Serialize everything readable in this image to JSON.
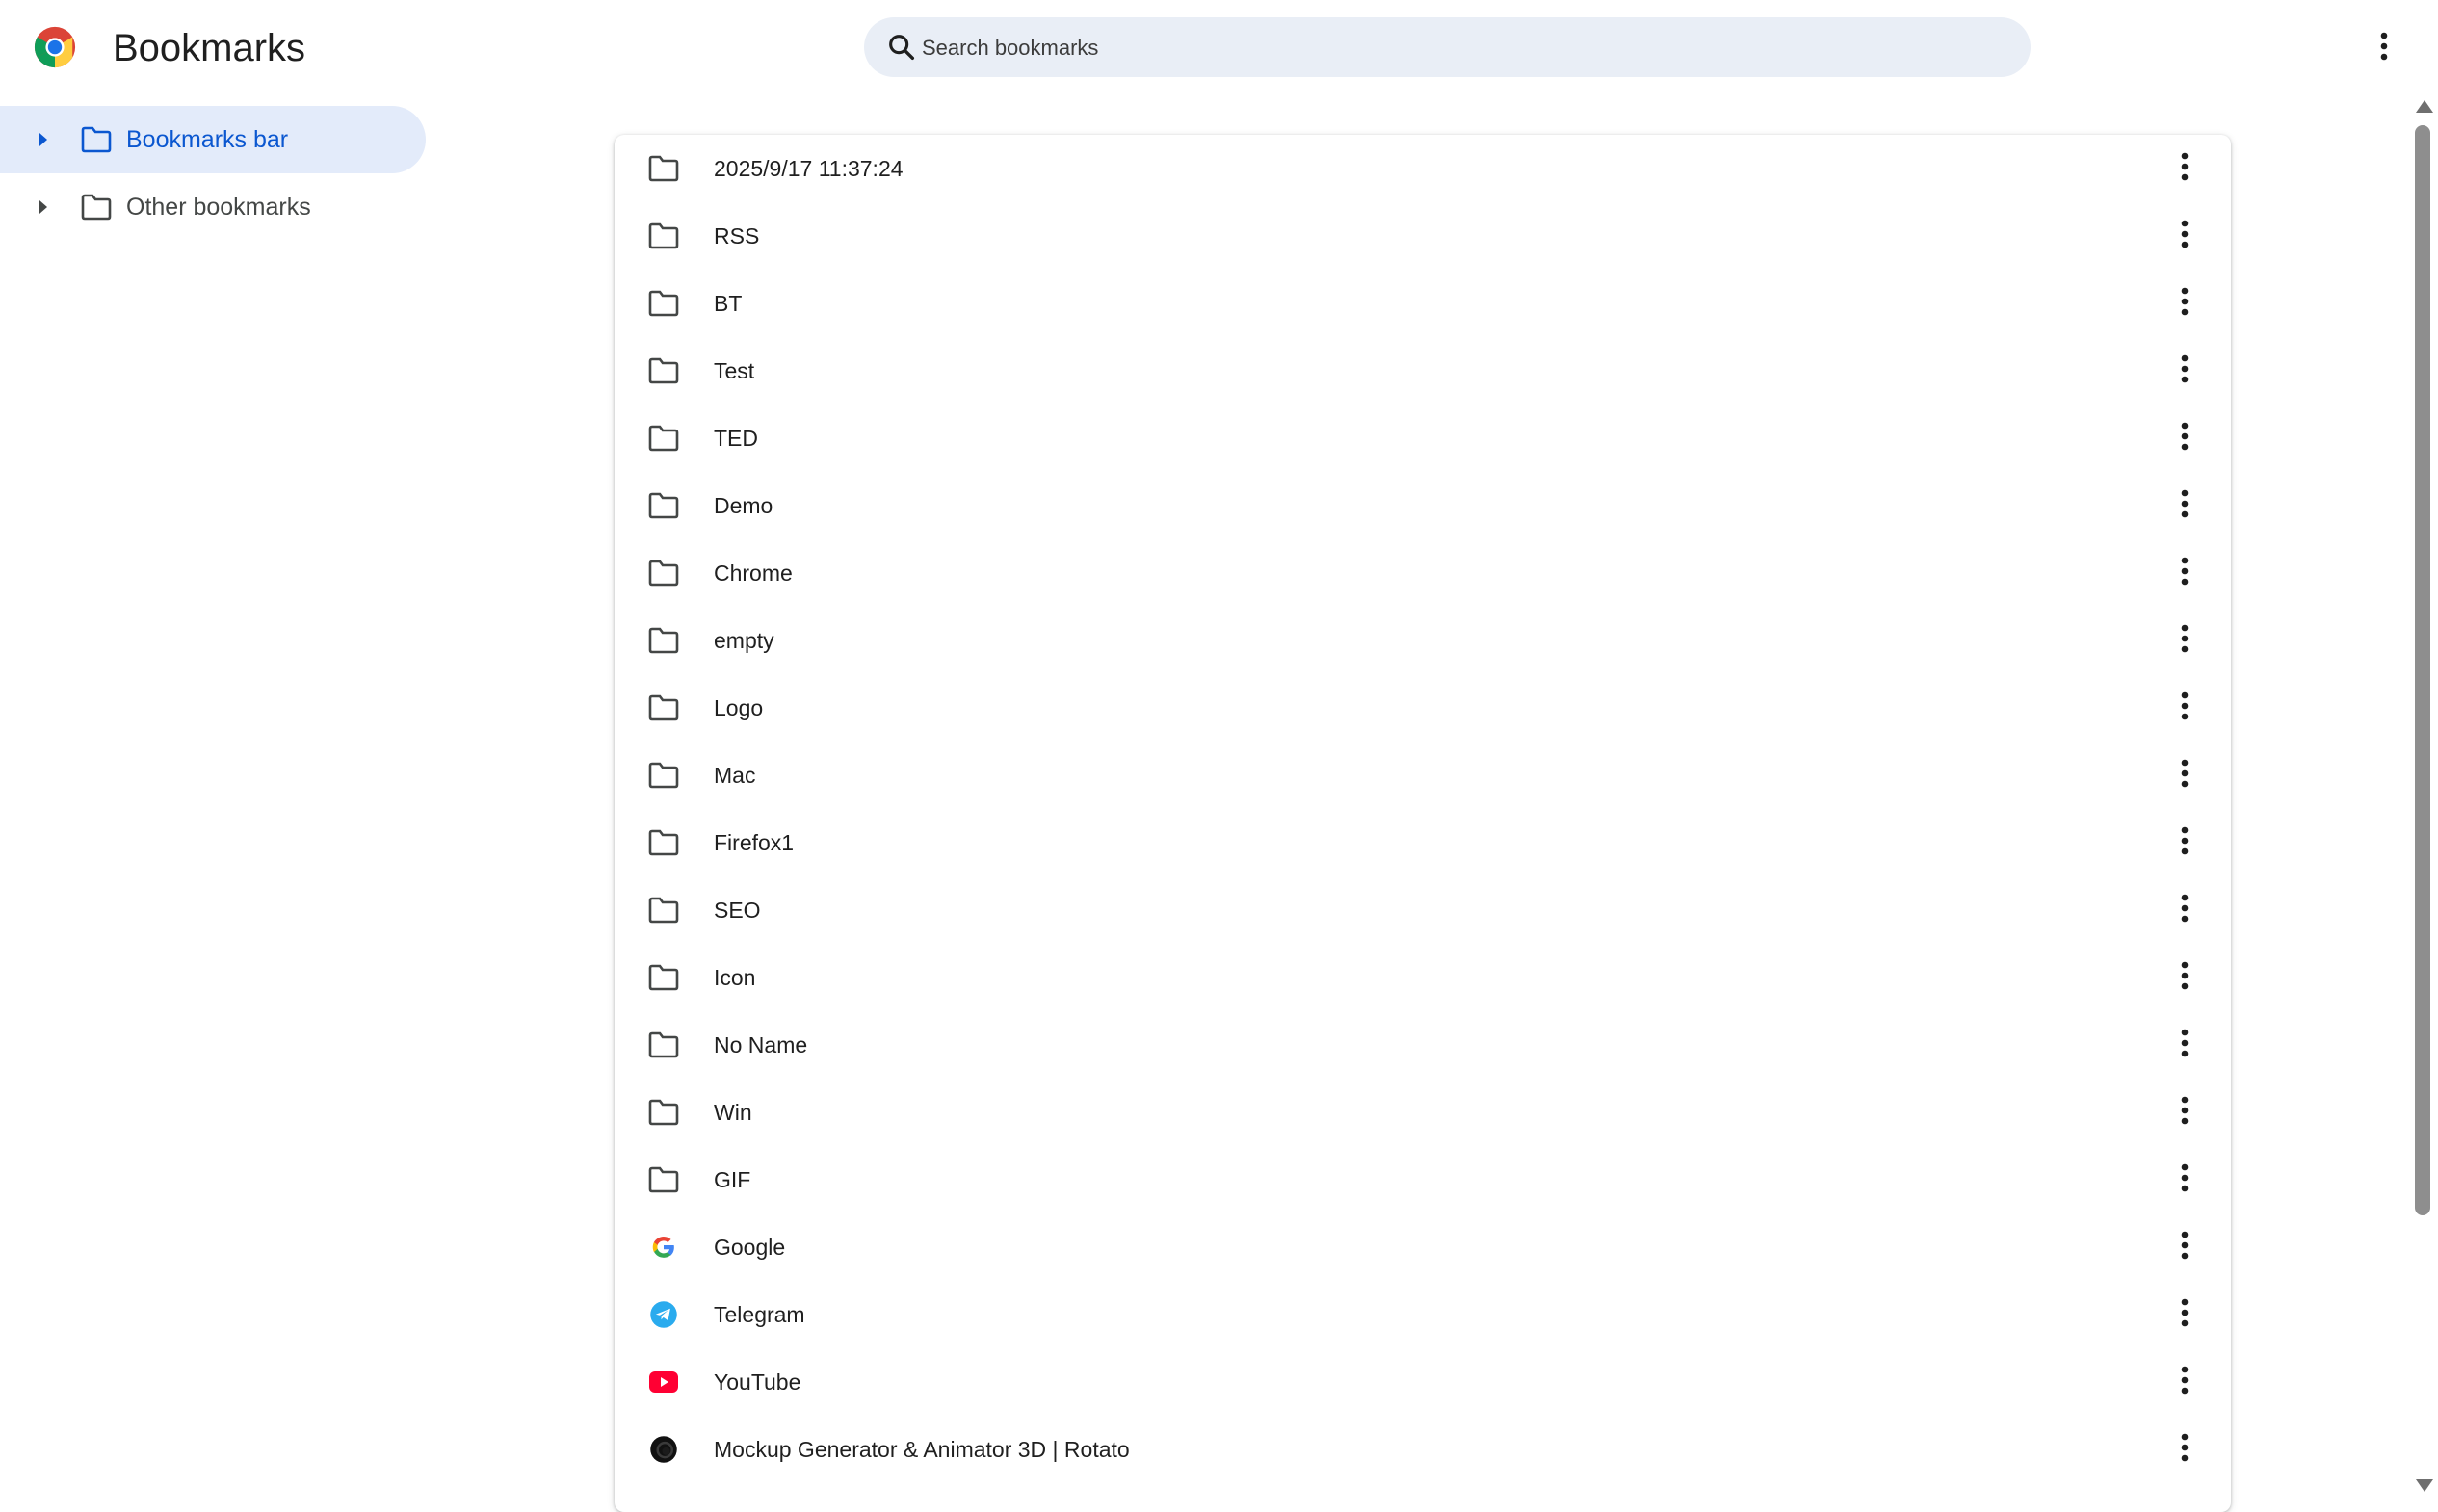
{
  "app": {
    "title": "Bookmarks"
  },
  "search": {
    "placeholder": "Search bookmarks",
    "value": ""
  },
  "sidebar": {
    "items": [
      {
        "label": "Bookmarks bar",
        "selected": true
      },
      {
        "label": "Other bookmarks",
        "selected": false
      }
    ]
  },
  "list": {
    "items": [
      {
        "title": "2025/9/17 11:37:24",
        "icon": "folder-icon"
      },
      {
        "title": "RSS",
        "icon": "folder-icon"
      },
      {
        "title": "BT",
        "icon": "folder-icon"
      },
      {
        "title": "Test",
        "icon": "folder-icon"
      },
      {
        "title": "TED",
        "icon": "folder-icon"
      },
      {
        "title": "Demo",
        "icon": "folder-icon"
      },
      {
        "title": "Chrome",
        "icon": "folder-icon"
      },
      {
        "title": "empty",
        "icon": "folder-icon"
      },
      {
        "title": "Logo",
        "icon": "folder-icon"
      },
      {
        "title": "Mac",
        "icon": "folder-icon"
      },
      {
        "title": "Firefox1",
        "icon": "folder-icon"
      },
      {
        "title": "SEO",
        "icon": "folder-icon"
      },
      {
        "title": "Icon",
        "icon": "folder-icon"
      },
      {
        "title": "No Name",
        "icon": "folder-icon"
      },
      {
        "title": "Win",
        "icon": "folder-icon"
      },
      {
        "title": "GIF",
        "icon": "folder-icon"
      },
      {
        "title": "Google",
        "icon": "google-favicon-icon"
      },
      {
        "title": "Telegram",
        "icon": "telegram-favicon-icon"
      },
      {
        "title": "YouTube",
        "icon": "youtube-favicon-icon"
      },
      {
        "title": "Mockup Generator & Animator 3D | Rotato",
        "icon": "rotato-favicon-icon"
      }
    ]
  },
  "colors": {
    "accent": "#0b57d0",
    "selected_bg": "#e3ebfa",
    "search_bg": "#e9eef6",
    "icon_gray": "#444746",
    "telegram": "#2aabee",
    "youtube": "#ff0033"
  }
}
